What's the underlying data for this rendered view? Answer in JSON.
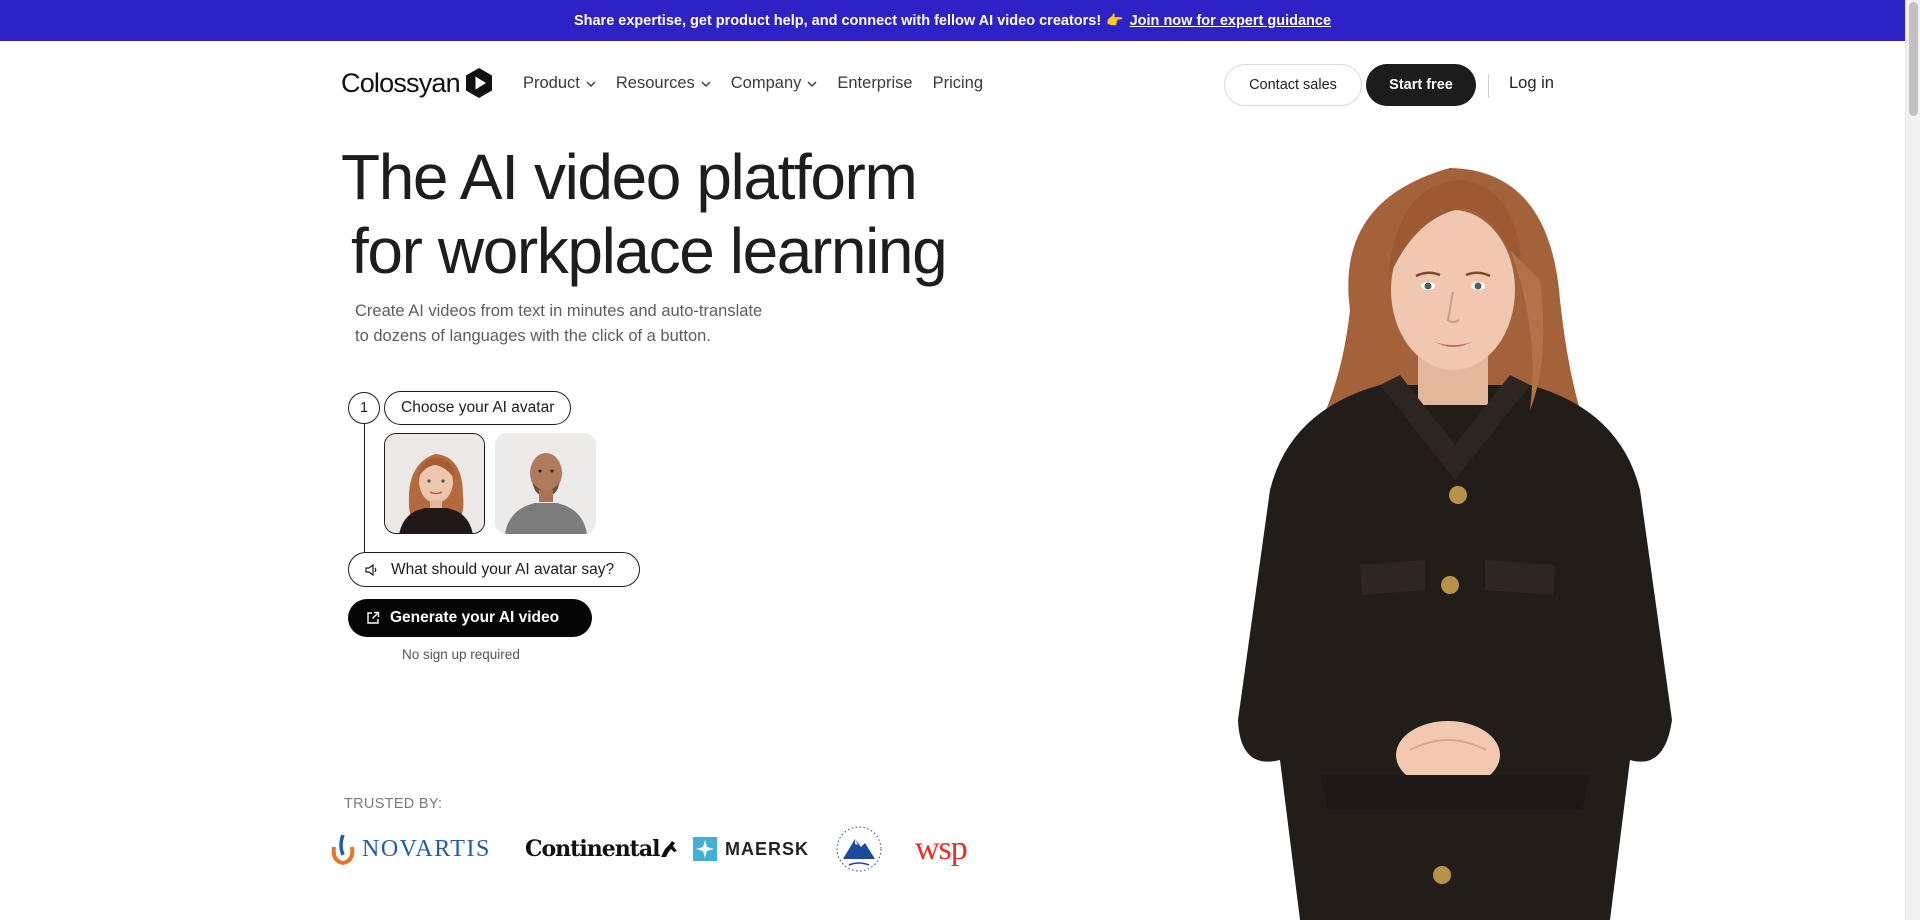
{
  "announcement": {
    "text": "Share expertise, get product help, and connect with fellow AI video creators!",
    "emoji": "👉",
    "link": "Join now for expert guidance"
  },
  "nav": {
    "logo": "Colossyan",
    "items": [
      {
        "label": "Product",
        "dropdown": true
      },
      {
        "label": "Resources",
        "dropdown": true
      },
      {
        "label": "Company",
        "dropdown": true
      },
      {
        "label": "Enterprise",
        "dropdown": false
      },
      {
        "label": "Pricing",
        "dropdown": false
      }
    ],
    "contact_sales": "Contact sales",
    "start_free": "Start free",
    "login": "Log in"
  },
  "hero": {
    "headline_line1": "The AI video platform",
    "headline_line2": "for workplace learning",
    "subtitle_line1": "Create AI videos from text in minutes and auto-translate",
    "subtitle_line2": "to dozens of languages with the click of a button."
  },
  "steps": {
    "step_number": "1",
    "choose_label": "Choose your AI avatar",
    "say_placeholder": "What should your AI avatar say?",
    "generate_label": "Generate your AI video",
    "no_signup": "No sign up required"
  },
  "trusted": {
    "label": "TRUSTED BY:",
    "brands": [
      "NOVARTIS",
      "Continental",
      "MAERSK",
      "Paramount",
      "wsp"
    ]
  },
  "colors": {
    "announcement_bg": "#2e22c7",
    "primary_button": "#1c1c1c",
    "novartis_blue": "#1f5da8",
    "wsp_red": "#e3302b",
    "maersk_cyan": "#42b0d5"
  }
}
